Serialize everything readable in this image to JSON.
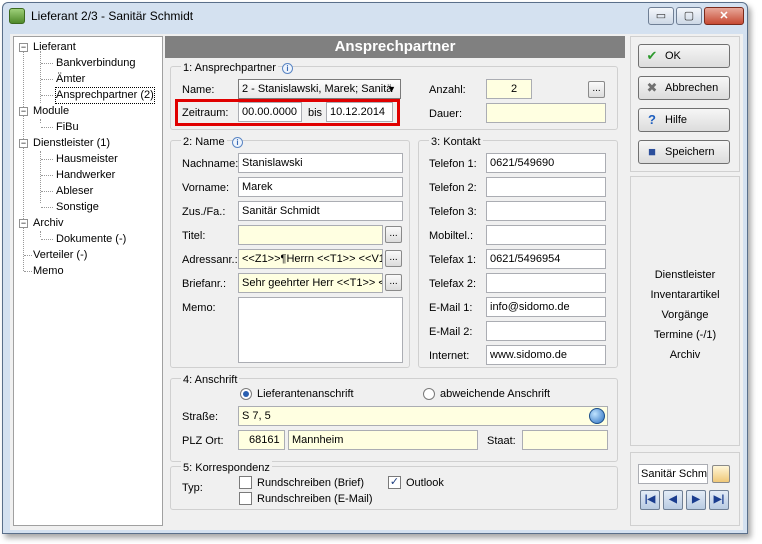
{
  "window": {
    "title": "Lieferant 2/3 - Sanitär Schmidt",
    "min_glyph": "▭",
    "max_glyph": "▢",
    "close_glyph": "✕"
  },
  "tree": {
    "items": [
      {
        "label": "Lieferant"
      },
      {
        "label": "Bankverbindung"
      },
      {
        "label": "Ämter"
      },
      {
        "label": "Ansprechpartner (2)"
      },
      {
        "label": "Module"
      },
      {
        "label": "FiBu"
      },
      {
        "label": "Dienstleister (1)"
      },
      {
        "label": "Hausmeister"
      },
      {
        "label": "Handwerker"
      },
      {
        "label": "Ableser"
      },
      {
        "label": "Sonstige"
      },
      {
        "label": "Archiv"
      },
      {
        "label": "Dokumente (-)"
      },
      {
        "label": "Verteiler (-)"
      },
      {
        "label": "Memo"
      }
    ],
    "collapse_glyph": "−"
  },
  "main": {
    "banner": "Ansprechpartner",
    "section1": {
      "title": "1: Ansprechpartner",
      "name_label": "Name:",
      "name_value": "2 - Stanislawski, Marek; Sanitä",
      "zeitraum_label": "Zeitraum:",
      "zeitraum_from": "00.00.0000",
      "bis_label": "bis",
      "zeitraum_to": "10.12.2014",
      "anzahl_label": "Anzahl:",
      "anzahl_value": "2",
      "dauer_label": "Dauer:",
      "dauer_value": ""
    },
    "section2": {
      "title": "2: Name",
      "nachname_label": "Nachname:",
      "nachname_value": "Stanislawski",
      "vorname_label": "Vorname:",
      "vorname_value": "Marek",
      "zus_label": "Zus./Fa.:",
      "zus_value": "Sanitär Schmidt",
      "titel_label": "Titel:",
      "titel_value": "",
      "adressanr_label": "Adressanr.:",
      "adressanr_value": "<<Z1>>¶Herrn <<T1>> <<V1:",
      "briefanr_label": "Briefanr.:",
      "briefanr_value": "Sehr geehrter Herr <<T1>> <<",
      "memo_label": "Memo:",
      "memo_value": ""
    },
    "section3": {
      "title": "3: Kontakt",
      "rows": [
        {
          "label": "Telefon 1:",
          "value": "0621/549690"
        },
        {
          "label": "Telefon 2:",
          "value": ""
        },
        {
          "label": "Telefon 3:",
          "value": ""
        },
        {
          "label": "Mobiltel.:",
          "value": ""
        },
        {
          "label": "Telefax 1:",
          "value": "0621/5496954"
        },
        {
          "label": "Telefax 2:",
          "value": ""
        },
        {
          "label": "E-Mail 1:",
          "value": "info@sidomo.de"
        },
        {
          "label": "E-Mail 2:",
          "value": ""
        },
        {
          "label": "Internet:",
          "value": "www.sidomo.de"
        }
      ]
    },
    "section4": {
      "title": "4: Anschrift",
      "radio1": "Lieferantenanschrift",
      "radio2": "abweichende Anschrift",
      "strasse_label": "Straße:",
      "strasse_value": "S 7, 5",
      "plz_label": "PLZ Ort:",
      "plz_value": "68161",
      "ort_value": "Mannheim",
      "staat_label": "Staat:",
      "staat_value": ""
    },
    "section5": {
      "title": "5: Korrespondenz",
      "typ_label": "Typ:",
      "check_brief": "Rundschreiben (Brief)",
      "check_email": "Rundschreiben (E-Mail)",
      "check_outlook": "Outlook"
    },
    "ellipsis": "..."
  },
  "buttons": {
    "ok": "OK",
    "abbrechen": "Abbrechen",
    "hilfe": "Hilfe",
    "speichern": "Speichern"
  },
  "side_links": [
    "Dienstleister",
    "Inventarartikel",
    "Vorgänge",
    "Termine (-/1)",
    "Archiv"
  ],
  "record_nav": {
    "current": "Sanitär Schm",
    "first": "|◀",
    "prev": "◀",
    "next": "▶",
    "last": "▶|"
  },
  "colors": {
    "highlight_border": "#e00000",
    "banner_bg": "#808080",
    "input_yellow": "#ffffe1"
  }
}
